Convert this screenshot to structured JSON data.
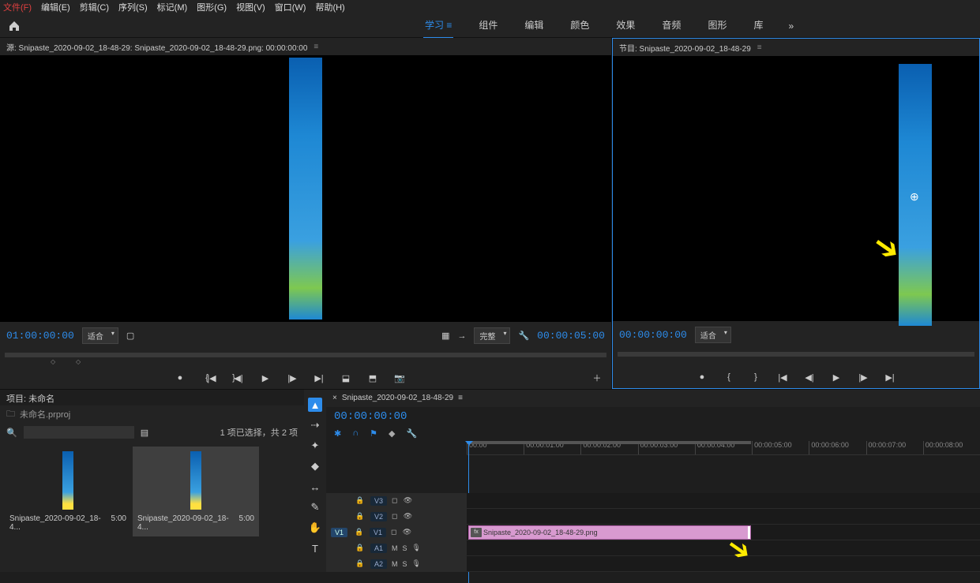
{
  "menu": [
    "文件(F)",
    "编辑(E)",
    "剪辑(C)",
    "序列(S)",
    "标记(M)",
    "图形(G)",
    "视图(V)",
    "窗口(W)",
    "帮助(H)"
  ],
  "workspace": {
    "tabs": [
      "学习",
      "组件",
      "编辑",
      "颜色",
      "效果",
      "音频",
      "图形",
      "库"
    ],
    "active_index": 0,
    "more": "»"
  },
  "source": {
    "tab_label": "源: Snipaste_2020-09-02_18-48-29: Snipaste_2020-09-02_18-48-29.png: 00:00:00:00",
    "timecode_in": "01:00:00:00",
    "zoom": "适合",
    "quality": "完整",
    "duration": "00:00:05:00"
  },
  "program": {
    "tab_label": "节目: Snipaste_2020-09-02_18-48-29",
    "timecode": "00:00:00:00",
    "zoom": "适合"
  },
  "project": {
    "tab_label": "项目: 未命名",
    "crumb": "未命名.prproj",
    "count": "1 项已选择，共 2 项",
    "bins": [
      {
        "name": "Snipaste_2020-09-02_18-4...",
        "dur": "5:00"
      },
      {
        "name": "Snipaste_2020-09-02_18-4...",
        "dur": "5:00"
      }
    ]
  },
  "timeline": {
    "tab_label": "Snipaste_2020-09-02_18-48-29",
    "timecode": "00:00:00:00",
    "ruler": [
      "00:00",
      "00:00:01:00",
      "00:00:02:00",
      "00:00:03:00",
      "00:00:04:00",
      "00:00:05:00",
      "00:00:06:00",
      "00:00:07:00",
      "00:00:08:00"
    ],
    "tracks_v": [
      "V3",
      "V2",
      "V1"
    ],
    "tracks_a": [
      "A1",
      "A2"
    ],
    "clip_name": "Snipaste_2020-09-02_18-48-29.png"
  }
}
